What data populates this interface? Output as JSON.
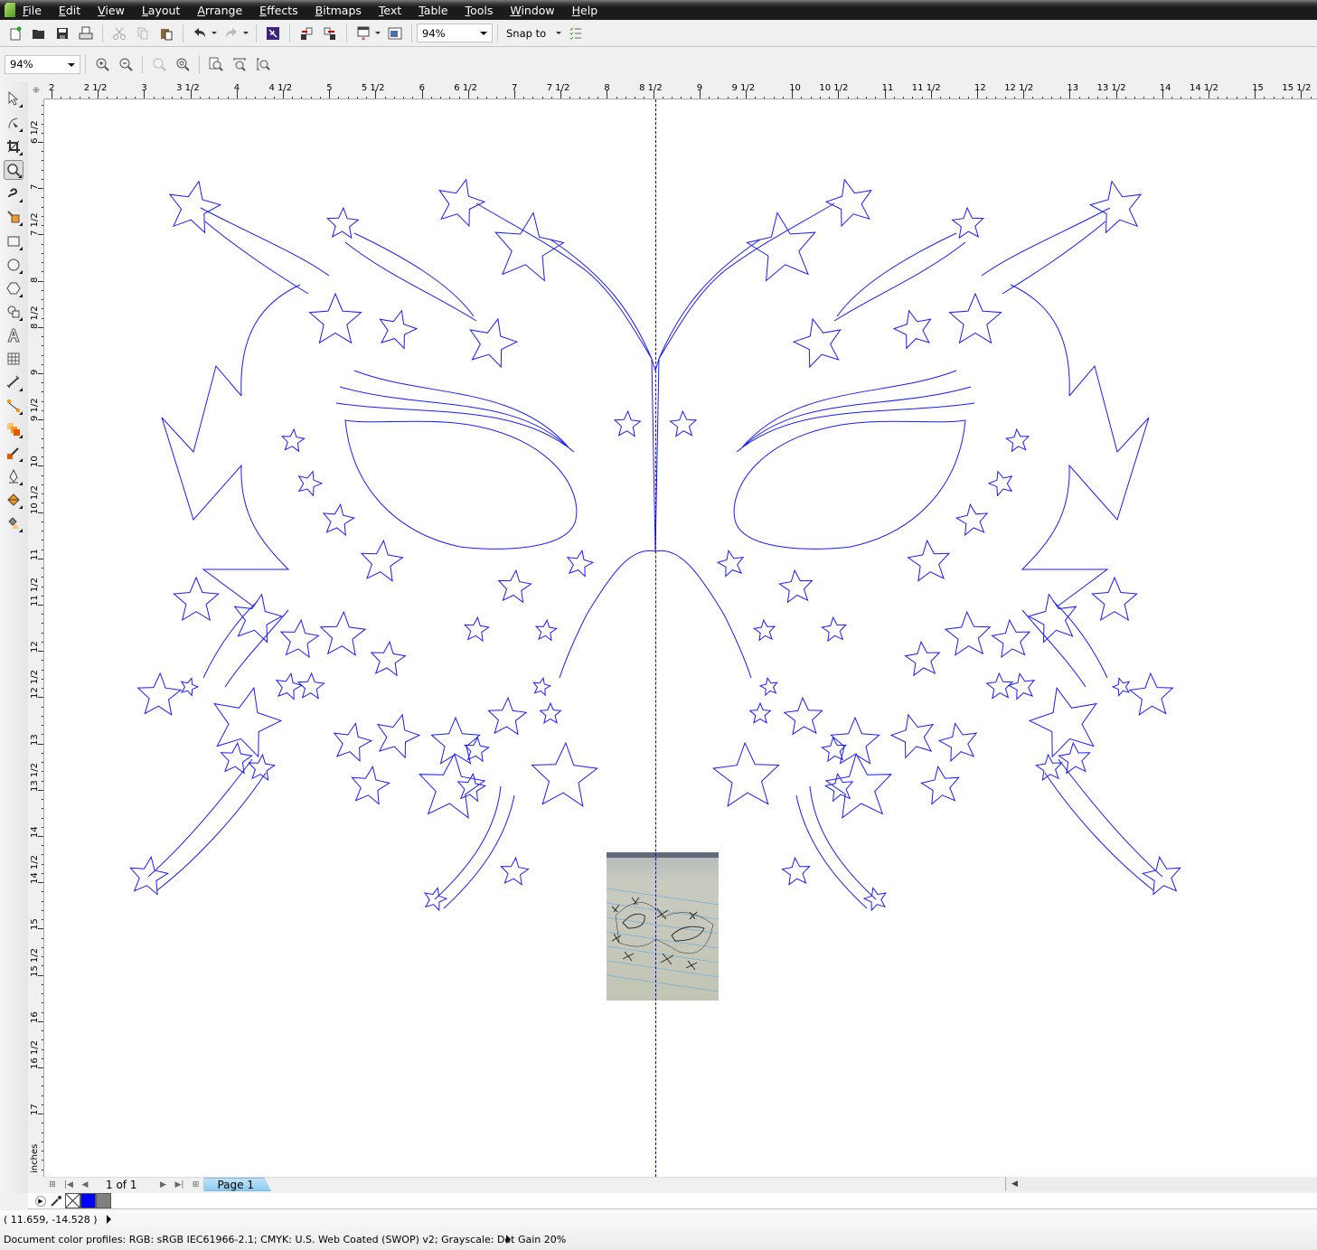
{
  "menubar": {
    "items": [
      "File",
      "Edit",
      "View",
      "Layout",
      "Arrange",
      "Effects",
      "Bitmaps",
      "Text",
      "Table",
      "Tools",
      "Window",
      "Help"
    ]
  },
  "toolbar_standard": {
    "buttons": [
      "new-icon",
      "open-icon",
      "save-icon",
      "print-icon",
      "cut-icon",
      "copy-icon",
      "paste-icon",
      "undo-icon",
      "redo-icon",
      "search-content-icon",
      "import-icon",
      "export-icon",
      "application-launcher-icon",
      "welcome-screen-icon"
    ],
    "zoom_level": "94%",
    "snap_label": "Snap to",
    "options_icon": "checklist-icon"
  },
  "toolbar_zoom": {
    "zoom_level": "94%",
    "buttons": [
      "zoom-in-icon",
      "zoom-out-icon",
      "zoom-to-selected-icon",
      "zoom-to-all-objects-icon",
      "zoom-to-page-icon",
      "zoom-to-page-width-icon",
      "zoom-to-page-height-icon"
    ]
  },
  "toolbox": {
    "tools": [
      "pick-tool",
      "shape-tool",
      "crop-tool",
      "zoom-tool",
      "freehand-tool",
      "smart-fill-tool",
      "rectangle-tool",
      "ellipse-tool",
      "polygon-tool",
      "basic-shapes-tool",
      "text-tool",
      "table-tool",
      "dimension-tool",
      "connector-tool",
      "blend-tool",
      "eyedropper-tool",
      "outline-tool",
      "fill-tool",
      "interactive-fill-tool"
    ],
    "active": "zoom-tool"
  },
  "rulers": {
    "unit": "inches",
    "horizontal_labels": [
      "2",
      "2 1/2",
      "3",
      "3 1/2",
      "4",
      "4 1/2",
      "5",
      "5 1/2",
      "6",
      "6 1/2",
      "7",
      "7 1/2",
      "8",
      "8 1/2",
      "9",
      "9 1/2",
      "10",
      "10 1/2",
      "11",
      "11 1/2",
      "12",
      "12 1/2",
      "13",
      "13 1/2",
      "14",
      "14 1/2",
      "15",
      "15 1/2"
    ],
    "vertical_labels": [
      "6 1/2",
      "7",
      "7 1/2",
      "8",
      "8 1/2",
      "9",
      "9 1/2",
      "10",
      "10 1/2",
      "11",
      "11 1/2",
      "12",
      "12 1/2",
      "13",
      "13 1/2",
      "14",
      "14 1/2",
      "15",
      "15 1/2",
      "16",
      "16 1/2",
      "17"
    ]
  },
  "canvas": {
    "outline_color": "#1a1aff",
    "guide_color": "#0000c8",
    "bitmap_label": "reference sketch photo"
  },
  "page_navigator": {
    "page_count": "1 of 1",
    "tabs": [
      "Page 1"
    ]
  },
  "palette": {
    "swatches": [
      {
        "name": "no-fill",
        "color": "none"
      },
      {
        "name": "blue",
        "color": "#0000ff"
      },
      {
        "name": "gray",
        "color": "#808080"
      }
    ]
  },
  "statusbar": {
    "coordinates": "( 11.659, -14.528 )",
    "color_profiles": "Document color profiles: RGB: sRGB IEC61966-2.1; CMYK: U.S. Web Coated (SWOP) v2; Grayscale: Dot Gain 20%"
  }
}
